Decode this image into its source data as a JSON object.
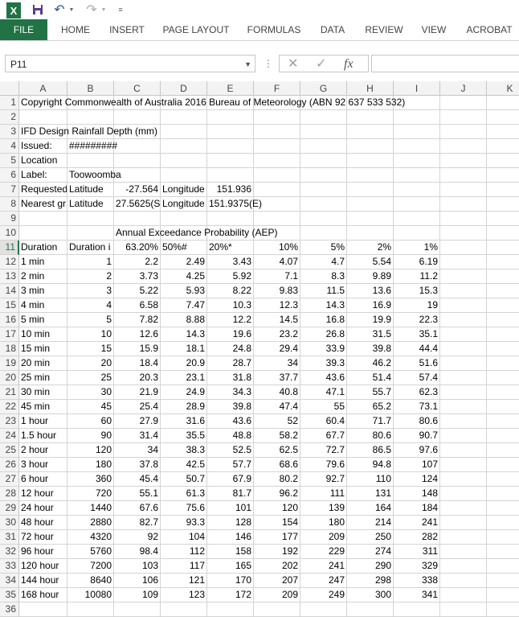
{
  "app": {
    "ribbon_tabs": [
      "FILE",
      "HOME",
      "INSERT",
      "PAGE LAYOUT",
      "FORMULAS",
      "DATA",
      "REVIEW",
      "VIEW",
      "ACROBAT"
    ],
    "active_tab": "FILE",
    "accent_color": "#217346",
    "logo_text": "X"
  },
  "formula_bar": {
    "name_box": "P11",
    "fx_label": "fx",
    "cancel_glyph": "✕",
    "enter_glyph": "✓",
    "value": ""
  },
  "columns": [
    "A",
    "B",
    "C",
    "D",
    "E",
    "F",
    "G",
    "H",
    "I",
    "J",
    "K"
  ],
  "rows": [
    {
      "n": "1",
      "cells": {
        "A": "Copyright Commonwealth of Australia 2016 Bureau of Meteorology (ABN 92 637 533 532)"
      }
    },
    {
      "n": "2",
      "cells": {}
    },
    {
      "n": "3",
      "cells": {
        "A": "IFD Design Rainfall Depth (mm)"
      }
    },
    {
      "n": "4",
      "cells": {
        "A": "Issued:",
        "B": "#########"
      }
    },
    {
      "n": "5",
      "cells": {
        "A": "Location"
      }
    },
    {
      "n": "6",
      "cells": {
        "A": "Label:",
        "B": "Toowoomba"
      }
    },
    {
      "n": "7",
      "cells": {
        "A": "Requested",
        "B": "Latitude",
        "C": "-27.564",
        "D": "Longitude",
        "E": "151.936"
      }
    },
    {
      "n": "8",
      "cells": {
        "A": "Nearest gr",
        "B": "Latitude",
        "C": "27.5625(S",
        "D": "Longitude",
        "E": "151.9375(E)"
      }
    },
    {
      "n": "9",
      "cells": {}
    },
    {
      "n": "10",
      "cells": {
        "C": "Annual Exceedance Probability (AEP)"
      }
    },
    {
      "n": "11",
      "cells": {
        "A": "Duration",
        "B": "Duration i",
        "C": "63.20%",
        "D": "50%#",
        "E": "20%*",
        "F": "10%",
        "G": "5%",
        "H": "2%",
        "I": "1%"
      }
    },
    {
      "n": "12",
      "cells": {
        "A": "1 min",
        "B": "1",
        "C": "2.2",
        "D": "2.49",
        "E": "3.43",
        "F": "4.07",
        "G": "4.7",
        "H": "5.54",
        "I": "6.19"
      }
    },
    {
      "n": "13",
      "cells": {
        "A": "2 min",
        "B": "2",
        "C": "3.73",
        "D": "4.25",
        "E": "5.92",
        "F": "7.1",
        "G": "8.3",
        "H": "9.89",
        "I": "11.2"
      }
    },
    {
      "n": "14",
      "cells": {
        "A": "3 min",
        "B": "3",
        "C": "5.22",
        "D": "5.93",
        "E": "8.22",
        "F": "9.83",
        "G": "11.5",
        "H": "13.6",
        "I": "15.3"
      }
    },
    {
      "n": "15",
      "cells": {
        "A": "4 min",
        "B": "4",
        "C": "6.58",
        "D": "7.47",
        "E": "10.3",
        "F": "12.3",
        "G": "14.3",
        "H": "16.9",
        "I": "19"
      }
    },
    {
      "n": "16",
      "cells": {
        "A": "5 min",
        "B": "5",
        "C": "7.82",
        "D": "8.88",
        "E": "12.2",
        "F": "14.5",
        "G": "16.8",
        "H": "19.9",
        "I": "22.3"
      }
    },
    {
      "n": "17",
      "cells": {
        "A": "10 min",
        "B": "10",
        "C": "12.6",
        "D": "14.3",
        "E": "19.6",
        "F": "23.2",
        "G": "26.8",
        "H": "31.5",
        "I": "35.1"
      }
    },
    {
      "n": "18",
      "cells": {
        "A": "15 min",
        "B": "15",
        "C": "15.9",
        "D": "18.1",
        "E": "24.8",
        "F": "29.4",
        "G": "33.9",
        "H": "39.8",
        "I": "44.4"
      }
    },
    {
      "n": "19",
      "cells": {
        "A": "20 min",
        "B": "20",
        "C": "18.4",
        "D": "20.9",
        "E": "28.7",
        "F": "34",
        "G": "39.3",
        "H": "46.2",
        "I": "51.6"
      }
    },
    {
      "n": "20",
      "cells": {
        "A": "25 min",
        "B": "25",
        "C": "20.3",
        "D": "23.1",
        "E": "31.8",
        "F": "37.7",
        "G": "43.6",
        "H": "51.4",
        "I": "57.4"
      }
    },
    {
      "n": "21",
      "cells": {
        "A": "30 min",
        "B": "30",
        "C": "21.9",
        "D": "24.9",
        "E": "34.3",
        "F": "40.8",
        "G": "47.1",
        "H": "55.7",
        "I": "62.3"
      }
    },
    {
      "n": "22",
      "cells": {
        "A": "45 min",
        "B": "45",
        "C": "25.4",
        "D": "28.9",
        "E": "39.8",
        "F": "47.4",
        "G": "55",
        "H": "65.2",
        "I": "73.1"
      }
    },
    {
      "n": "23",
      "cells": {
        "A": "1 hour",
        "B": "60",
        "C": "27.9",
        "D": "31.6",
        "E": "43.6",
        "F": "52",
        "G": "60.4",
        "H": "71.7",
        "I": "80.6"
      }
    },
    {
      "n": "24",
      "cells": {
        "A": "1.5 hour",
        "B": "90",
        "C": "31.4",
        "D": "35.5",
        "E": "48.8",
        "F": "58.2",
        "G": "67.7",
        "H": "80.6",
        "I": "90.7"
      }
    },
    {
      "n": "25",
      "cells": {
        "A": "2 hour",
        "B": "120",
        "C": "34",
        "D": "38.3",
        "E": "52.5",
        "F": "62.5",
        "G": "72.7",
        "H": "86.5",
        "I": "97.6"
      }
    },
    {
      "n": "26",
      "cells": {
        "A": "3 hour",
        "B": "180",
        "C": "37.8",
        "D": "42.5",
        "E": "57.7",
        "F": "68.6",
        "G": "79.6",
        "H": "94.8",
        "I": "107"
      }
    },
    {
      "n": "27",
      "cells": {
        "A": "6 hour",
        "B": "360",
        "C": "45.4",
        "D": "50.7",
        "E": "67.9",
        "F": "80.2",
        "G": "92.7",
        "H": "110",
        "I": "124"
      }
    },
    {
      "n": "28",
      "cells": {
        "A": "12 hour",
        "B": "720",
        "C": "55.1",
        "D": "61.3",
        "E": "81.7",
        "F": "96.2",
        "G": "111",
        "H": "131",
        "I": "148"
      }
    },
    {
      "n": "29",
      "cells": {
        "A": "24 hour",
        "B": "1440",
        "C": "67.6",
        "D": "75.6",
        "E": "101",
        "F": "120",
        "G": "139",
        "H": "164",
        "I": "184"
      }
    },
    {
      "n": "30",
      "cells": {
        "A": "48 hour",
        "B": "2880",
        "C": "82.7",
        "D": "93.3",
        "E": "128",
        "F": "154",
        "G": "180",
        "H": "214",
        "I": "241"
      }
    },
    {
      "n": "31",
      "cells": {
        "A": "72 hour",
        "B": "4320",
        "C": "92",
        "D": "104",
        "E": "146",
        "F": "177",
        "G": "209",
        "H": "250",
        "I": "282"
      }
    },
    {
      "n": "32",
      "cells": {
        "A": "96 hour",
        "B": "5760",
        "C": "98.4",
        "D": "112",
        "E": "158",
        "F": "192",
        "G": "229",
        "H": "274",
        "I": "311"
      }
    },
    {
      "n": "33",
      "cells": {
        "A": "120 hour",
        "B": "7200",
        "C": "103",
        "D": "117",
        "E": "165",
        "F": "202",
        "G": "241",
        "H": "290",
        "I": "329"
      }
    },
    {
      "n": "34",
      "cells": {
        "A": "144 hour",
        "B": "8640",
        "C": "106",
        "D": "121",
        "E": "170",
        "F": "207",
        "G": "247",
        "H": "298",
        "I": "338"
      }
    },
    {
      "n": "35",
      "cells": {
        "A": "168 hour",
        "B": "10080",
        "C": "109",
        "D": "123",
        "E": "172",
        "F": "209",
        "G": "249",
        "H": "300",
        "I": "341"
      }
    },
    {
      "n": "36",
      "cells": {}
    }
  ],
  "selected_row": "11"
}
